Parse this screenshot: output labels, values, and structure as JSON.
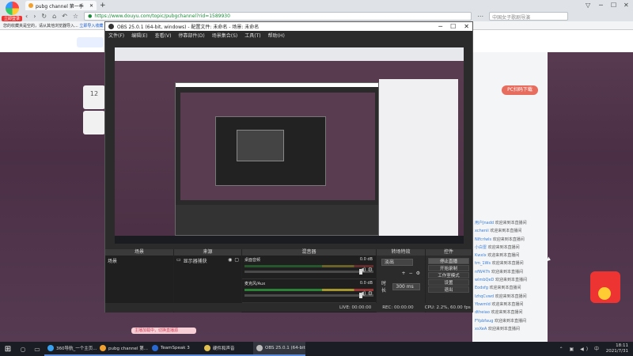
{
  "browser": {
    "brand_badge": "立即登录",
    "tab_title": "pubg channel 第一季",
    "address_url": "https://www.douyu.com/topic/pubgchannel?rid=1589930",
    "search_placeholder": "中国女子歌剧导演",
    "bookmark_text": "您的收藏夹是空的，请从其他浏览器导入...",
    "bookmark_link": "立即导入收藏",
    "window_controls": [
      "▽",
      "─",
      "☐",
      "✕"
    ]
  },
  "page": {
    "pc_button": "PC扫码下载",
    "left_card_count": "12",
    "pink_bar_text": "主播加载中，切换直播源",
    "chat": [
      {
        "user": "用户Jnadd",
        "text": "欢迎来到本直播间"
      },
      {
        "user": "xchenii",
        "text": "欢迎来到本直播间"
      },
      {
        "user": "Nlfcrlwls",
        "text": "欢迎来到本直播间"
      },
      {
        "user": "小白雷",
        "text": "欢迎来到本直播间"
      },
      {
        "user": "Kwxlx",
        "text": "欢迎来到本直播间"
      },
      {
        "user": "tm_1Ws",
        "text": "欢迎来到本直播间"
      },
      {
        "user": "nfW47h",
        "text": "欢迎来到本直播间"
      },
      {
        "user": "wlmbQeD",
        "text": "欢迎来到本直播间"
      },
      {
        "user": "Eodsfg",
        "text": "欢迎来到本直播间"
      },
      {
        "user": "lzhqCvwd",
        "text": "欢迎来到本直播间"
      },
      {
        "user": "Ybwmld",
        "text": "欢迎来到本直播间"
      },
      {
        "user": "dtheiao",
        "text": "欢迎来到本直播间"
      },
      {
        "user": "FYpbfaug",
        "text": "欢迎来到本直播间"
      },
      {
        "user": "xsXeA",
        "text": "欢迎来到本直播间"
      }
    ]
  },
  "obs": {
    "title": "OBS 25.0.1 (64-bit, windows) - 配置文件: 未命名 - 场景: 未命名",
    "menu": [
      "文件(F)",
      "编辑(E)",
      "查看(V)",
      "停靠部件(D)",
      "场景集合(S)",
      "工具(T)",
      "帮助(H)"
    ],
    "docks": {
      "scenes": {
        "title": "场景",
        "item": "场景"
      },
      "sources": {
        "title": "来源",
        "item": "显示器捕获"
      },
      "mixer": {
        "title": "混音器",
        "channels": [
          {
            "name": "桌面音频",
            "db": "0.0 dB"
          },
          {
            "name": "麦克风/Aux",
            "db": "0.0 dB"
          }
        ]
      },
      "transitions": {
        "title": "转场特效",
        "type": "淡出",
        "duration_label": "时长",
        "duration": "300 ms"
      },
      "controls": {
        "title": "控件",
        "buttons": [
          "停止直播",
          "开始录制",
          "工作室模式",
          "设置",
          "退出"
        ]
      }
    },
    "status": {
      "live": "LIVE: 00:00:00",
      "rec": "REC: 00:00:00",
      "cpu": "CPU: 2.2%, 60.00 fps"
    }
  },
  "taskbar": {
    "buttons": [
      {
        "label": "360导航_一个主页...",
        "color": "#3aa0f0"
      },
      {
        "label": "pubg channel 第...",
        "color": "#f0a030"
      },
      {
        "label": "TeamSpeak 3",
        "color": "#2a6ad0"
      },
      {
        "label": "硬件和声音",
        "color": "#e0c050"
      },
      {
        "label": "OBS 25.0.1 (64-bit...",
        "color": "#bbbbbb"
      }
    ],
    "time": "18:11",
    "date": "2021/7/31"
  }
}
